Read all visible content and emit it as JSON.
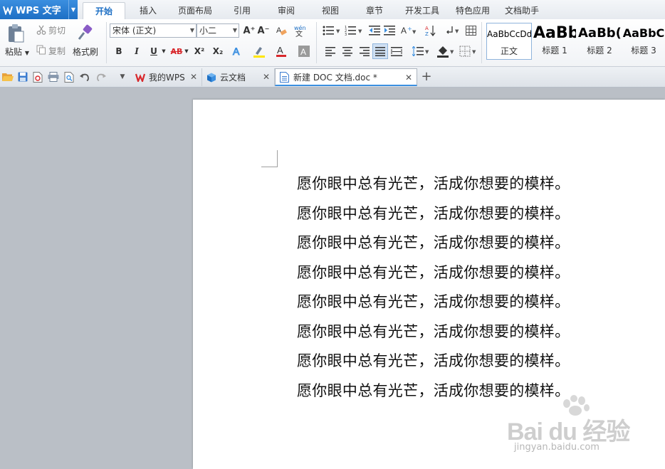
{
  "app": {
    "title": "WPS 文字"
  },
  "menu": {
    "tabs": [
      "开始",
      "插入",
      "页面布局",
      "引用",
      "审阅",
      "视图",
      "章节",
      "开发工具",
      "特色应用",
      "文档助手"
    ],
    "active": "开始"
  },
  "ribbon": {
    "paste_label": "粘贴",
    "cut_label": "剪切",
    "copy_label": "复制",
    "format_painter_label": "格式刷",
    "font_name": "宋体 (正文)",
    "font_size": "小二",
    "bold_glyph": "B",
    "italic_glyph": "I",
    "underline_glyph": "U",
    "strike_glyph": "AB",
    "superscript_glyph": "X²",
    "subscript_glyph": "X₂",
    "grow_glyph": "A⁺",
    "shrink_glyph": "A⁻",
    "styles": [
      {
        "sample": "AaBbCcDd",
        "name": "正文"
      },
      {
        "sample": "AaBb",
        "name": "标题 1"
      },
      {
        "sample": "AaBb(",
        "name": "标题 2"
      },
      {
        "sample": "AaBbC",
        "name": "标题 3"
      }
    ]
  },
  "doctabs": [
    {
      "label": "我的WPS",
      "icon": "wps-icon"
    },
    {
      "label": "云文档",
      "icon": "cloud-cube-icon"
    },
    {
      "label": "新建 DOC 文档.doc *",
      "icon": "doc-icon"
    }
  ],
  "document": {
    "lines": [
      "愿你眼中总有光芒，活成你想要的模样。",
      "愿你眼中总有光芒，活成你想要的模样。",
      "愿你眼中总有光芒，活成你想要的模样。",
      "愿你眼中总有光芒，活成你想要的模样。",
      "愿你眼中总有光芒，活成你想要的模样。",
      "愿你眼中总有光芒，活成你想要的模样。",
      "愿你眼中总有光芒，活成你想要的模样。",
      "愿你眼中总有光芒，活成你想要的模样。"
    ]
  },
  "watermark": {
    "text": "Bai du 经验",
    "url": "jingyan.baidu.com"
  },
  "colors": {
    "accent": "#1d6fc4",
    "workspace": "#babfc6",
    "wps_red": "#d8282c"
  }
}
